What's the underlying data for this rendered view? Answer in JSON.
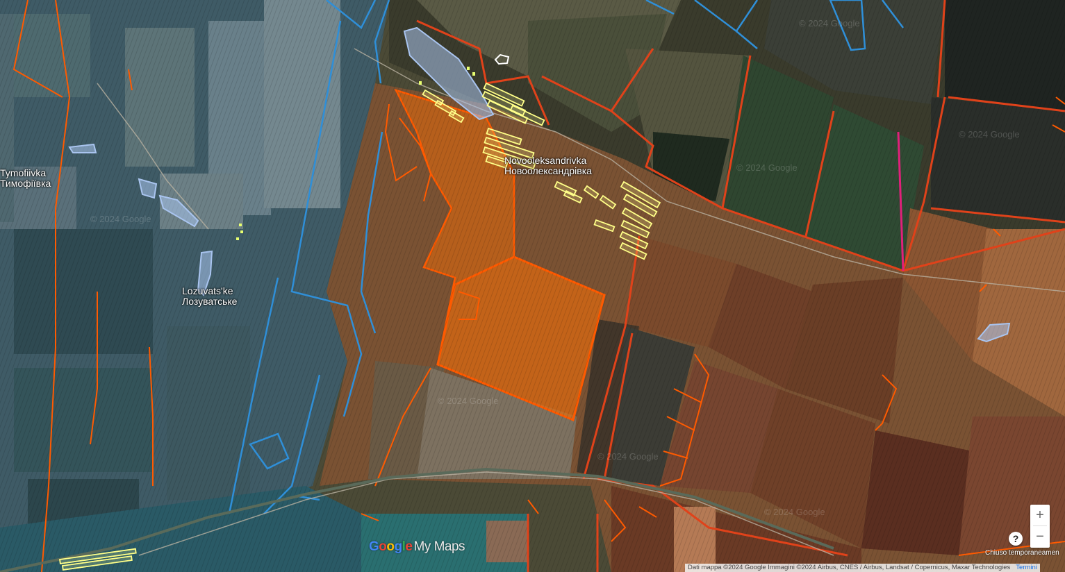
{
  "map": {
    "places": [
      {
        "latin": "Tymofiivka",
        "cyrillic": "Тимофіївка"
      },
      {
        "latin": "Novooleksandrivka",
        "cyrillic": "Новоолександрівка"
      },
      {
        "latin": "Lozuvats'ke",
        "cyrillic": "Лозуватське"
      }
    ],
    "watermark": "© 2024 Google",
    "colors": {
      "blue_zone": "#2f8fd8",
      "orange_zone": "#ff5a00",
      "dark_orange": "#e0421a",
      "magenta_line": "#e0207a",
      "yellow_buildings": "#ffff88",
      "water": "#a9c4ef"
    }
  },
  "controls": {
    "zoom_in": "+",
    "zoom_out": "−",
    "help": "?"
  },
  "branding": {
    "google": [
      "G",
      "o",
      "o",
      "g",
      "l",
      "e"
    ],
    "mymaps": "My Maps"
  },
  "footer": {
    "attribution": "Dati mappa ©2024 Google Immagini ©2024 Airbus, CNES / Airbus, Landsat / Copernicus, Maxar Technologies",
    "terms": "Termini",
    "closed_note": "Chiuso temporaneamen"
  },
  "icons": {
    "zoom_in": "plus-icon",
    "zoom_out": "minus-icon",
    "help": "question-mark-icon"
  }
}
